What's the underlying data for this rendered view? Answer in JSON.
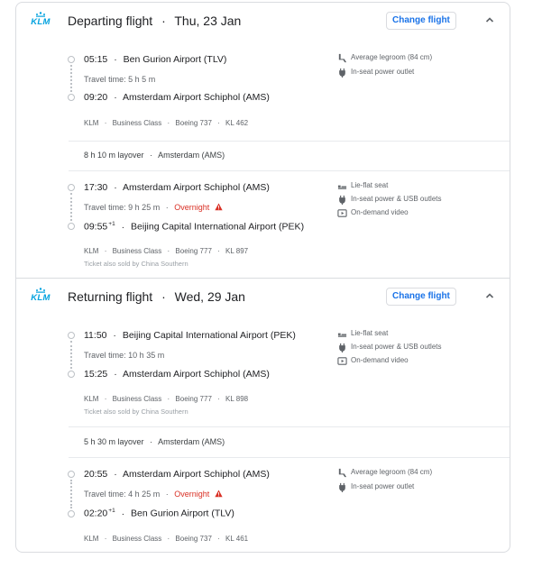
{
  "airline": {
    "logo_text": "KLM",
    "brand_color": "#00a1de"
  },
  "separator": "·",
  "change_flight_label": "Change flight",
  "accent_color": "#1a73e8",
  "overnight_color": "#d93025",
  "departing": {
    "title": "Departing flight",
    "date": "Thu, 23 Jan",
    "legs": [
      {
        "dep_time": "05:15",
        "dep_airport": "Ben Gurion Airport (TLV)",
        "travel_time": "Travel time: 5 h 5 m",
        "overnight": "",
        "arr_time": "09:20",
        "arr_sup": "",
        "arr_airport": "Amsterdam Airport Schiphol (AMS)",
        "meta": [
          "KLM",
          "Business Class",
          "Boeing 737",
          "KL 462"
        ],
        "sold_by": "",
        "amenities": [
          {
            "icon": "legroom-icon",
            "label": "Average legroom (84 cm)"
          },
          {
            "icon": "power-outlet-icon",
            "label": "In-seat power outlet"
          }
        ]
      },
      {
        "dep_time": "17:30",
        "dep_airport": "Amsterdam Airport Schiphol (AMS)",
        "travel_time": "Travel time: 9 h 25 m",
        "overnight": "Overnight",
        "arr_time": "09:55",
        "arr_sup": "+1",
        "arr_airport": "Beijing Capital International Airport (PEK)",
        "meta": [
          "KLM",
          "Business Class",
          "Boeing 777",
          "KL 897"
        ],
        "sold_by": "Ticket also sold by China Southern",
        "amenities": [
          {
            "icon": "lie-flat-seat-icon",
            "label": "Lie-flat seat"
          },
          {
            "icon": "power-usb-icon",
            "label": "In-seat power & USB outlets"
          },
          {
            "icon": "video-icon",
            "label": "On-demand video"
          }
        ]
      }
    ],
    "layover": {
      "duration": "8 h 10 m layover",
      "place": "Amsterdam (AMS)"
    }
  },
  "returning": {
    "title": "Returning flight",
    "date": "Wed, 29 Jan",
    "legs": [
      {
        "dep_time": "11:50",
        "dep_airport": "Beijing Capital International Airport (PEK)",
        "travel_time": "Travel time: 10 h 35 m",
        "overnight": "",
        "arr_time": "15:25",
        "arr_sup": "",
        "arr_airport": "Amsterdam Airport Schiphol (AMS)",
        "meta": [
          "KLM",
          "Business Class",
          "Boeing 777",
          "KL 898"
        ],
        "sold_by": "Ticket also sold by China Southern",
        "amenities": [
          {
            "icon": "lie-flat-seat-icon",
            "label": "Lie-flat seat"
          },
          {
            "icon": "power-usb-icon",
            "label": "In-seat power & USB outlets"
          },
          {
            "icon": "video-icon",
            "label": "On-demand video"
          }
        ]
      },
      {
        "dep_time": "20:55",
        "dep_airport": "Amsterdam Airport Schiphol (AMS)",
        "travel_time": "Travel time: 4 h 25 m",
        "overnight": "Overnight",
        "arr_time": "02:20",
        "arr_sup": "+1",
        "arr_airport": "Ben Gurion Airport (TLV)",
        "meta": [
          "KLM",
          "Business Class",
          "Boeing 737",
          "KL 461"
        ],
        "sold_by": "",
        "amenities": [
          {
            "icon": "legroom-icon",
            "label": "Average legroom (84 cm)"
          },
          {
            "icon": "power-outlet-icon",
            "label": "In-seat power outlet"
          }
        ]
      }
    ],
    "layover": {
      "duration": "5 h 30 m layover",
      "place": "Amsterdam (AMS)"
    }
  }
}
